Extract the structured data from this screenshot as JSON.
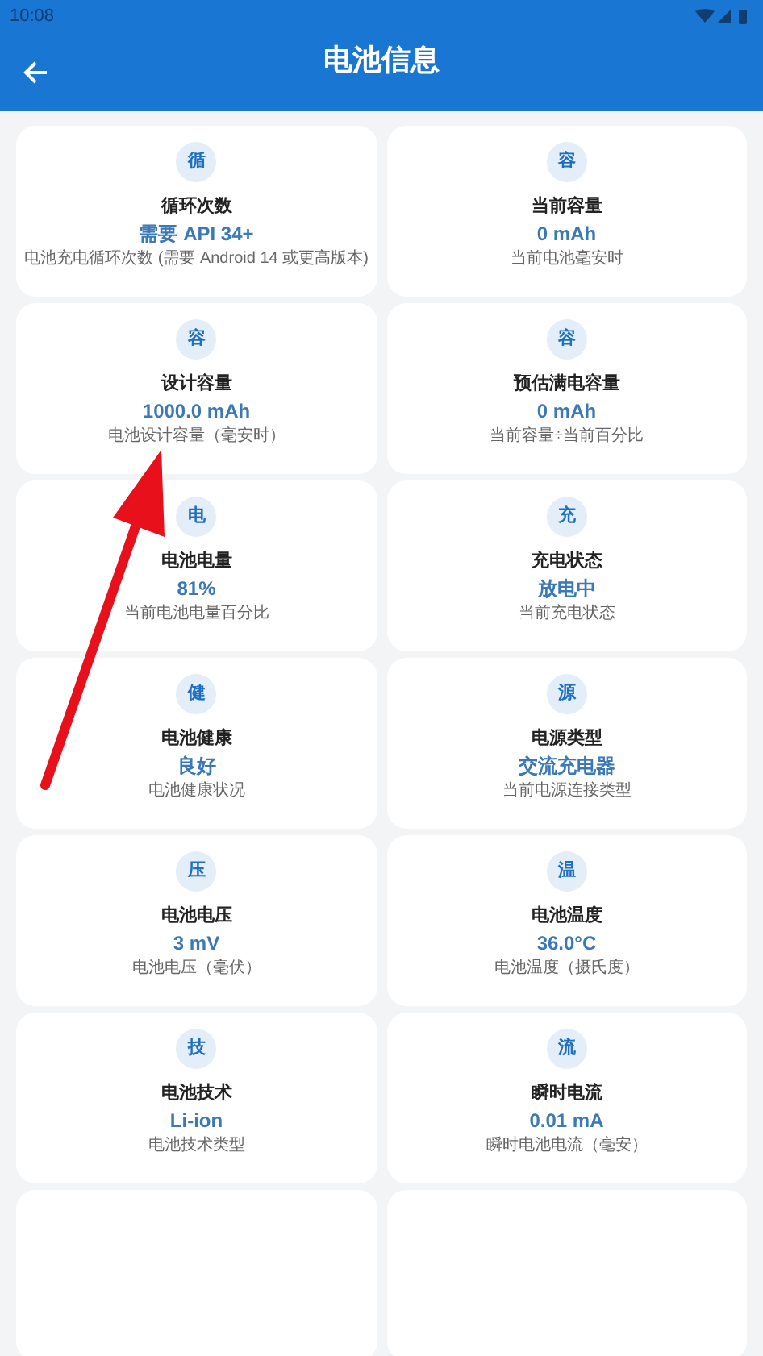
{
  "status_bar": {
    "time": "10:08"
  },
  "app_bar": {
    "title": "电池信息"
  },
  "cards": [
    {
      "badge": "循",
      "title": "循环次数",
      "value": "需要 API 34+",
      "description": "电池充电循环次数 (需要 Android 14 或更高版本)"
    },
    {
      "badge": "容",
      "title": "当前容量",
      "value": "0 mAh",
      "description": "当前电池毫安时"
    },
    {
      "badge": "容",
      "title": "设计容量",
      "value": "1000.0 mAh",
      "description": "电池设计容量（毫安时）"
    },
    {
      "badge": "容",
      "title": "预估满电容量",
      "value": "0 mAh",
      "description": "当前容量÷当前百分比"
    },
    {
      "badge": "电",
      "title": "电池电量",
      "value": "81%",
      "description": "当前电池电量百分比"
    },
    {
      "badge": "充",
      "title": "充电状态",
      "value": "放电中",
      "description": "当前充电状态"
    },
    {
      "badge": "健",
      "title": "电池健康",
      "value": "良好",
      "description": "电池健康状况"
    },
    {
      "badge": "源",
      "title": "电源类型",
      "value": "交流充电器",
      "description": "当前电源连接类型"
    },
    {
      "badge": "压",
      "title": "电池电压",
      "value": "3 mV",
      "description": "电池电压（毫伏）"
    },
    {
      "badge": "温",
      "title": "电池温度",
      "value": "36.0°C",
      "description": "电池温度（摄氏度）"
    },
    {
      "badge": "技",
      "title": "电池技术",
      "value": "Li-ion",
      "description": "电池技术类型"
    },
    {
      "badge": "流",
      "title": "瞬时电流",
      "value": "0.01 mA",
      "description": "瞬时电池电流（毫安）"
    },
    {
      "kind": "empty"
    },
    {
      "kind": "empty"
    }
  ]
}
